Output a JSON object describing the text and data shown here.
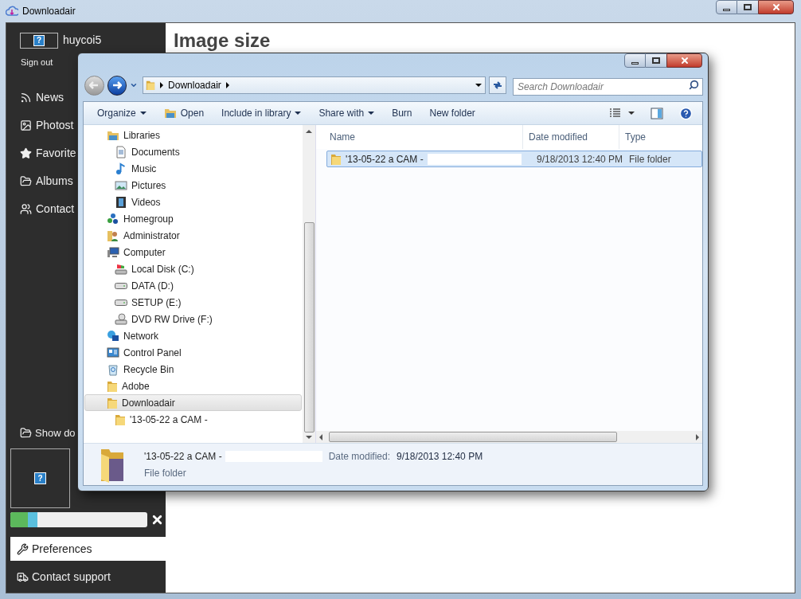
{
  "window": {
    "title": "Downloadair"
  },
  "user": {
    "avatar_icon": "?",
    "name": "huycoi5",
    "sign_out": "Sign out"
  },
  "thumbnail": {
    "icon": "?"
  },
  "sidebar": {
    "items": [
      {
        "kind": "rss",
        "label": "News",
        "selected": false
      },
      {
        "kind": "image",
        "label": "Photost",
        "selected": false
      },
      {
        "kind": "star",
        "label": "Favorite",
        "selected": false
      },
      {
        "kind": "albums",
        "label": "Albums",
        "selected": false
      },
      {
        "kind": "users",
        "label": "Contact",
        "selected": false
      }
    ],
    "show_downloads": {
      "kind": "folder",
      "label": "Show do"
    },
    "progress": {
      "level": 0.2
    },
    "footer": [
      {
        "kind": "wrench",
        "label": "Preferences",
        "selected": true
      },
      {
        "kind": "ambulance",
        "label": "Contact support",
        "selected": false
      }
    ]
  },
  "content": {
    "heading": "Image size"
  },
  "dialog": {
    "address": {
      "crumbs": [
        "Downloadair"
      ]
    },
    "search": {
      "placeholder": "Search Downloadair"
    },
    "toolbar": [
      {
        "label": "Organize",
        "has_menu": true,
        "kind": "text"
      },
      {
        "label": "Open",
        "has_menu": false,
        "kind": "open"
      },
      {
        "label": "Include in library",
        "has_menu": true,
        "kind": "text"
      },
      {
        "label": "Share with",
        "has_menu": true,
        "kind": "text"
      },
      {
        "label": "Burn",
        "has_menu": false,
        "kind": "text"
      },
      {
        "label": "New folder",
        "has_menu": false,
        "kind": "text"
      }
    ],
    "tree": [
      {
        "label": "Libraries",
        "kind": "library",
        "selected": false,
        "children": [
          {
            "label": "Documents",
            "kind": "document",
            "selected": false
          },
          {
            "label": "Music",
            "kind": "music",
            "selected": false
          },
          {
            "label": "Pictures",
            "kind": "pictures",
            "selected": false
          },
          {
            "label": "Videos",
            "kind": "videos",
            "selected": false
          }
        ]
      },
      {
        "label": "Homegroup",
        "kind": "homegroup",
        "selected": false
      },
      {
        "label": "Administrator",
        "kind": "user",
        "selected": false
      },
      {
        "label": "Computer",
        "kind": "computer",
        "selected": false,
        "children": [
          {
            "label": "Local Disk (C:)",
            "kind": "system-disk",
            "selected": false
          },
          {
            "label": "DATA (D:)",
            "kind": "disk",
            "selected": false
          },
          {
            "label": "SETUP (E:)",
            "kind": "disk",
            "selected": false
          },
          {
            "label": "DVD RW Drive (F:)",
            "kind": "dvd",
            "selected": false
          }
        ]
      },
      {
        "label": "Network",
        "kind": "network",
        "selected": false
      },
      {
        "label": "Control Panel",
        "kind": "control-panel",
        "selected": false
      },
      {
        "label": "Recycle Bin",
        "kind": "recycle-bin",
        "selected": false
      },
      {
        "label": "Adobe",
        "kind": "folder",
        "selected": false
      },
      {
        "label": "Downloadair",
        "kind": "folder",
        "selected": true,
        "children": [
          {
            "label": "'13-05-22 a CAM -",
            "kind": "folder",
            "selected": false
          }
        ]
      }
    ],
    "columns": [
      "Name",
      "Date modified",
      "Type"
    ],
    "rows": [
      {
        "name": "'13-05-22 a CAM -",
        "date": "9/18/2013 12:40 PM",
        "type": "File folder",
        "selected": true
      }
    ],
    "details": {
      "name": "'13-05-22 a CAM -",
      "type": "File folder",
      "date_label": "Date modified:",
      "date": "9/18/2013 12:40 PM"
    }
  }
}
